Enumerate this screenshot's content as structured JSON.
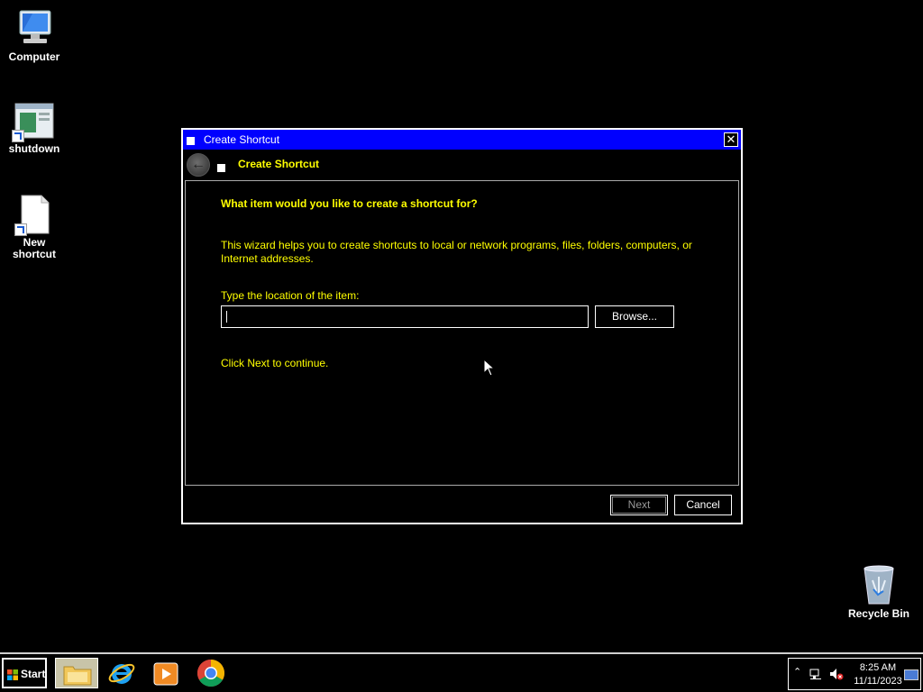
{
  "desktop": {
    "icons": [
      {
        "label": "Computer"
      },
      {
        "label": "shutdown"
      },
      {
        "label": "New shortcut"
      },
      {
        "label": "Recycle Bin"
      }
    ]
  },
  "dialog": {
    "window_title": "Create Shortcut",
    "wizard_title": "Create Shortcut",
    "question": "What item would you like to create a shortcut for?",
    "description": "This wizard helps you to create shortcuts to local or network programs, files, folders, computers, or Internet addresses.",
    "location_label": "Type the location of the item:",
    "location_value": "",
    "browse_label": "Browse...",
    "continue_text": "Click Next to continue.",
    "next_label": "Next",
    "cancel_label": "Cancel",
    "close_glyph": "✕"
  },
  "taskbar": {
    "start_label": "Start",
    "pinned": [
      {
        "name": "File Explorer",
        "icon": "folder-icon"
      },
      {
        "name": "Internet Explorer",
        "icon": "ie-icon"
      },
      {
        "name": "Windows Media Player",
        "icon": "media-player-icon"
      },
      {
        "name": "Google Chrome",
        "icon": "chrome-icon"
      }
    ],
    "time": "8:25 AM",
    "date": "11/11/2023"
  },
  "colors": {
    "titlebar": "#0000ff",
    "text_highlight": "#ffff00",
    "background": "#000000"
  }
}
